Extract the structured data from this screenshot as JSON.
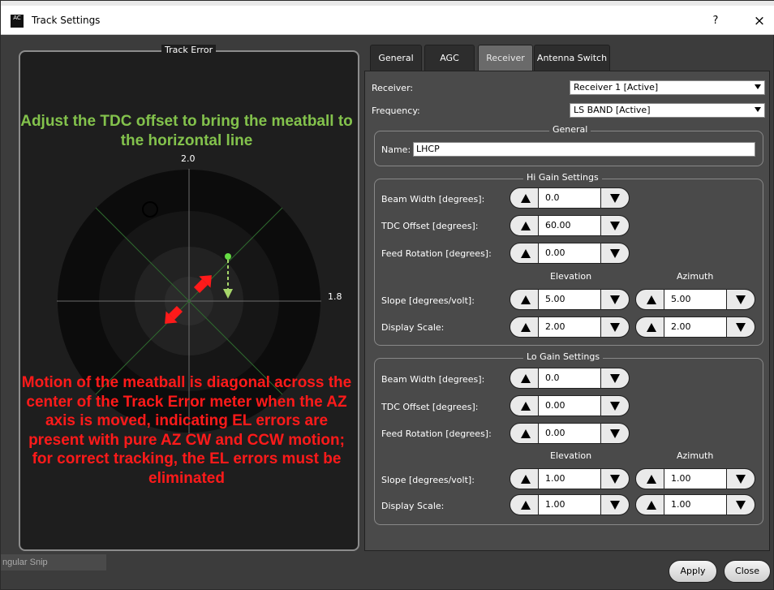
{
  "window": {
    "title": "Track Settings",
    "help": "?",
    "close": "×",
    "icon_text": "AC"
  },
  "track_error": {
    "title": "Track Error",
    "label_top": "2.0",
    "label_right": "1.8",
    "green_note": "Adjust the TDC offset to bring the meatball to the horizontal line",
    "red_note": "Motion of the meatball is diagonal across the center of the Track Error meter when the AZ axis is moved, indicating EL errors are present with pure AZ CW and CCW motion; for correct tracking, the EL errors must be eliminated",
    "colors": {
      "green": "#83c24c",
      "red": "#ff1a1a"
    }
  },
  "snip_label": "ngular Snip",
  "tabs": [
    "General",
    "AGC",
    "Receiver",
    "Antenna Switch"
  ],
  "active_tab": "Receiver",
  "receiver": {
    "receiver_label": "Receiver:",
    "receiver_value": "Receiver 1 [Active]",
    "frequency_label": "Frequency:",
    "frequency_value": "LS BAND [Active]",
    "general_title": "General",
    "name_label": "Name:",
    "name_value": "LHCP"
  },
  "hi_gain": {
    "title": "Hi Gain Settings",
    "beam_width_label": "Beam Width [degrees]:",
    "beam_width": "0.0",
    "tdc_label": "TDC Offset [degrees]:",
    "tdc": "60.00",
    "feed_label": "Feed Rotation [degrees]:",
    "feed": "0.00",
    "elevation": "Elevation",
    "azimuth": "Azimuth",
    "slope_label": "Slope [degrees/volt]:",
    "slope_el": "5.00",
    "slope_az": "5.00",
    "scale_label": "Display Scale:",
    "scale_el": "2.00",
    "scale_az": "2.00"
  },
  "lo_gain": {
    "title": "Lo Gain Settings",
    "beam_width_label": "Beam Width [degrees]:",
    "beam_width": "0.0",
    "tdc_label": "TDC Offset [degrees]:",
    "tdc": "0.00",
    "feed_label": "Feed Rotation [degrees]:",
    "feed": "0.00",
    "elevation": "Elevation",
    "azimuth": "Azimuth",
    "slope_label": "Slope [degrees/volt]:",
    "slope_el": "1.00",
    "slope_az": "1.00",
    "scale_label": "Display Scale:",
    "scale_el": "1.00",
    "scale_az": "1.00"
  },
  "buttons": {
    "apply": "Apply",
    "close": "Close"
  }
}
